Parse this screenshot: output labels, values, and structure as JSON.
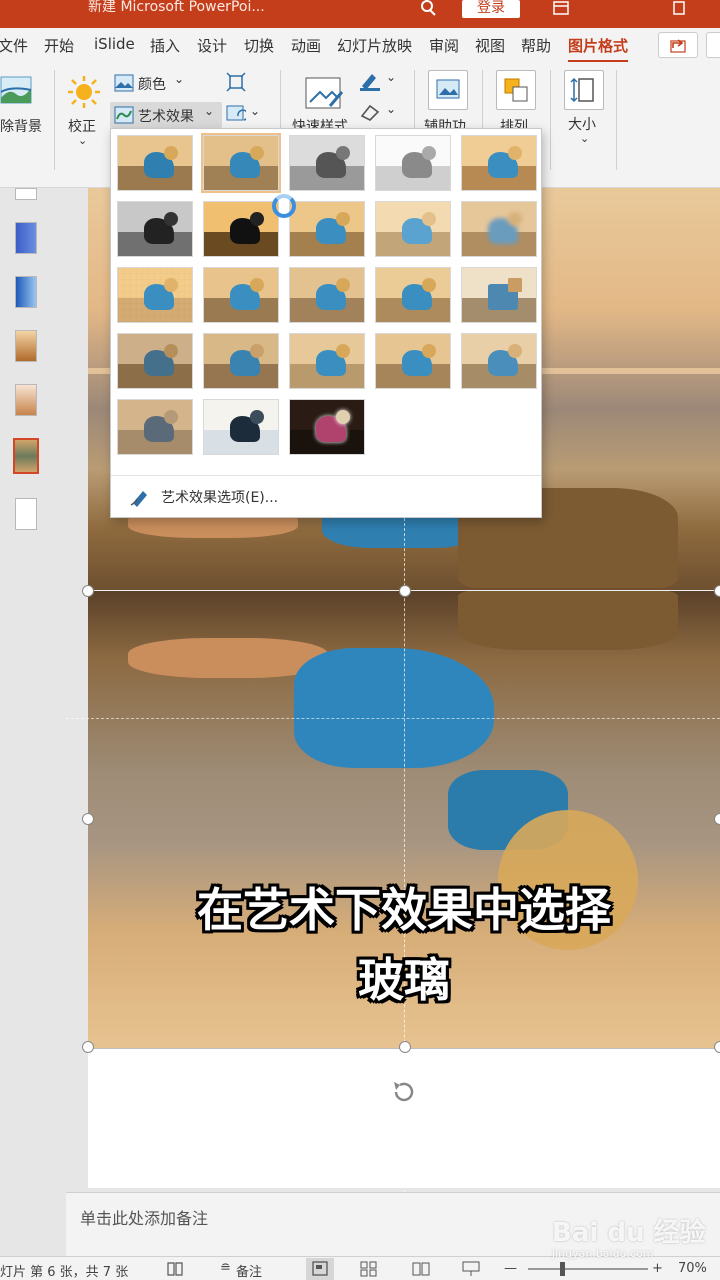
{
  "titlebar": {
    "title": "新建 Microsoft PowerPoi...",
    "login": "登录"
  },
  "tabs": [
    {
      "label": "文件"
    },
    {
      "label": "开始"
    },
    {
      "label": "iSlide"
    },
    {
      "label": "插入"
    },
    {
      "label": "设计"
    },
    {
      "label": "切换"
    },
    {
      "label": "动画"
    },
    {
      "label": "幻灯片放映"
    },
    {
      "label": "审阅"
    },
    {
      "label": "视图"
    },
    {
      "label": "帮助"
    },
    {
      "label": "图片格式",
      "active": true
    }
  ],
  "ribbon": {
    "remove_bg": "除背景",
    "correct": "校正",
    "color": "颜色",
    "art_effects": "艺术效果",
    "quick_styles": "快速样式",
    "accessibility": "辅助功",
    "arrange": "排列",
    "size": "大小"
  },
  "art_effects_menu": {
    "options_label": "艺术效果选项(E)...",
    "effects_count": 23,
    "selected_index": 1
  },
  "slide": {
    "caption_line1": "在艺术下效果中选择",
    "caption_line2": "玻璃"
  },
  "notes": {
    "placeholder": "单击此处添加备注"
  },
  "statusbar": {
    "slide_info": "灯片 第 6 张，共 7 张",
    "notes_label": "备注",
    "zoom": "70%"
  },
  "thumbnails": [
    {
      "index": 1
    },
    {
      "index": 2
    },
    {
      "index": 3
    },
    {
      "index": 4
    },
    {
      "index": 5
    },
    {
      "index": 6,
      "selected": true
    },
    {
      "index": 7
    }
  ],
  "watermark": {
    "brand": "Bai du 经验",
    "url": "jingyan.baidu.com"
  },
  "colors": {
    "accent": "#c43e1c",
    "selected_thumb": "#d24726"
  }
}
